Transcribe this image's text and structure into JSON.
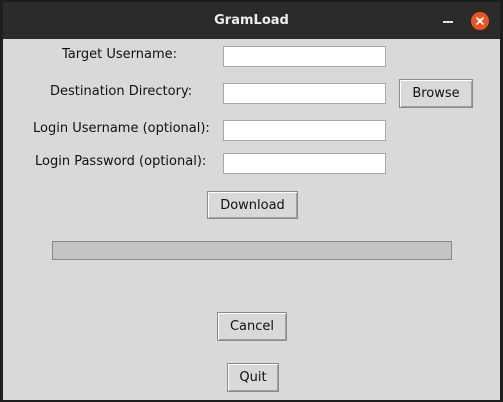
{
  "window": {
    "title": "GramLoad"
  },
  "titlebar": {
    "minimize_icon": "minimize-icon",
    "close_icon": "close-icon",
    "close_color": "#e95420"
  },
  "form": {
    "target_username_label": "Target Username:",
    "target_username_value": "",
    "destination_directory_label": "Destination Directory:",
    "destination_directory_value": "",
    "browse_label": "Browse",
    "login_username_label": "Login Username (optional):",
    "login_username_value": "",
    "login_password_label": "Login Password (optional):",
    "login_password_value": ""
  },
  "actions": {
    "download_label": "Download",
    "cancel_label": "Cancel",
    "quit_label": "Quit"
  },
  "progress": {
    "fraction": 0
  }
}
